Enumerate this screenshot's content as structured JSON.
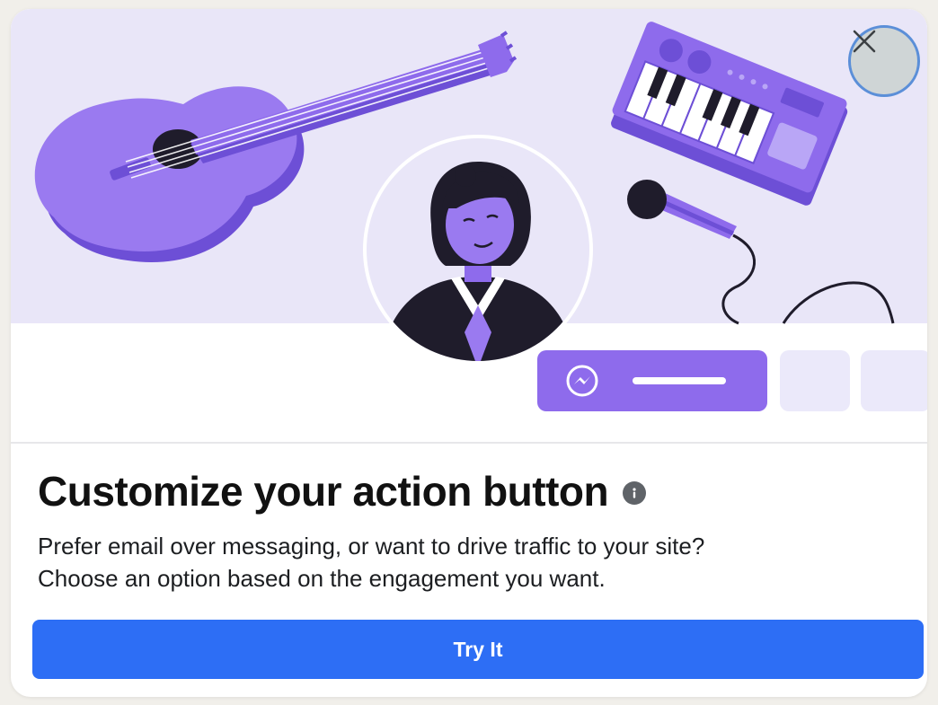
{
  "dialog": {
    "title": "Customize your action button",
    "description_line1": "Prefer email over messaging, or want to drive traffic to your site?",
    "description_line2": "Choose an option based on the engagement you want.",
    "primary_button_label": "Try It"
  },
  "icons": {
    "close": "close-icon",
    "info": "info-icon",
    "messenger": "messenger-icon"
  },
  "colors": {
    "illustration_bg": "#e9e6f8",
    "purple": "#8e6bec",
    "purple_dark": "#6d4fd6",
    "light_tile": "#ebe9fa",
    "primary_blue": "#2d6ef5",
    "close_bg": "#cfd5d6",
    "close_border": "#5b8fd8"
  }
}
